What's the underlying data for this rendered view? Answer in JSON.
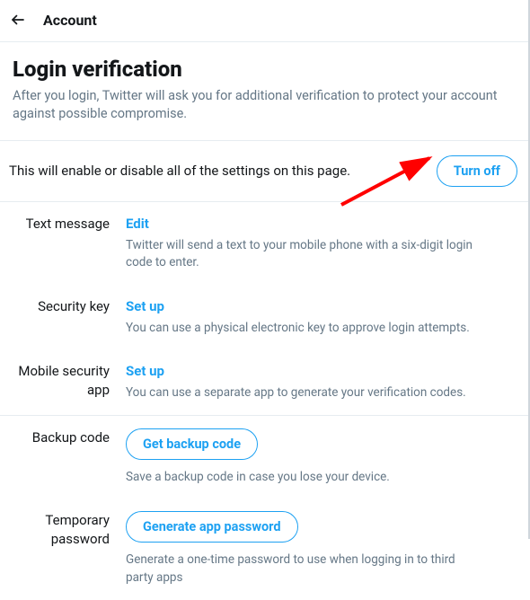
{
  "topbar": {
    "title": "Account"
  },
  "header": {
    "title": "Login verification",
    "description": "After you login, Twitter will ask you for additional verification to protect your account against possible compromise."
  },
  "toggle": {
    "text": "This will enable or disable all of the settings on this page.",
    "button_label": "Turn off"
  },
  "methods": {
    "text_message": {
      "label": "Text message",
      "action": "Edit",
      "description": "Twitter will send a text to your mobile phone with a six-digit login code to enter."
    },
    "security_key": {
      "label": "Security key",
      "action": "Set up",
      "description": "You can use a physical electronic key to approve login attempts."
    },
    "mobile_security_app": {
      "label": "Mobile security app",
      "action": "Set up",
      "description": "You can use a separate app to generate your verification codes."
    }
  },
  "backup": {
    "backup_code": {
      "label": "Backup code",
      "button": "Get backup code",
      "description": "Save a backup code in case you lose your device."
    },
    "temp_password": {
      "label": "Temporary password",
      "button": "Generate app password",
      "description": "Generate a one-time password to use when logging in to third party apps"
    }
  }
}
